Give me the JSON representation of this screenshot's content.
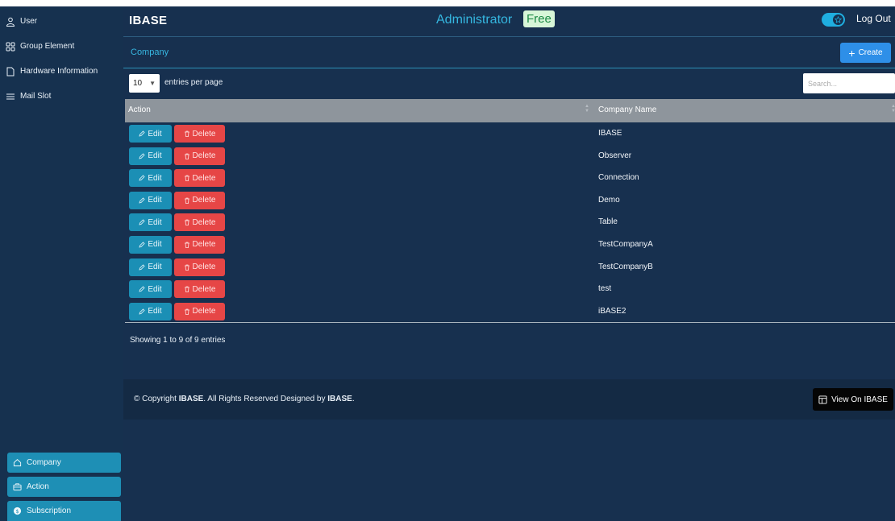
{
  "sidebar": {
    "items": [
      {
        "label": "User",
        "icon": "user-icon"
      },
      {
        "label": "Group Element",
        "icon": "grid-icon"
      },
      {
        "label": "Hardware Information",
        "icon": "file-icon"
      },
      {
        "label": "Mail Slot",
        "icon": "menu-icon"
      }
    ],
    "bottom_items": [
      {
        "label": "Company",
        "icon": "home-icon"
      },
      {
        "label": "Action",
        "icon": "briefcase-icon"
      },
      {
        "label": "Subscription",
        "icon": "coin-icon"
      }
    ]
  },
  "header": {
    "brand": "IBASE",
    "role": "Administrator",
    "plan_badge": "Free",
    "logout_label": "Log Out",
    "toggle_on": true
  },
  "card": {
    "title": "Company",
    "create_label": "Create",
    "entries_value": "10",
    "entries_label": "entries per page",
    "search_placeholder": "Search...",
    "columns": [
      "Action",
      "Company Name"
    ],
    "edit_label": "Edit",
    "delete_label": "Delete",
    "rows": [
      "IBASE",
      "Observer",
      "Connection",
      "Demo",
      "Table",
      "TestCompanyA",
      "TestCompanyB",
      "test",
      "iBASE2"
    ],
    "showing_text": "Showing 1 to 9 of 9 entries"
  },
  "footer": {
    "copyright_prefix": "© Copyright ",
    "copyright_brand": "IBASE",
    "copyright_middle": ". All Rights Reserved Designed by ",
    "copyright_brand2": "IBASE",
    "copyright_suffix": ".",
    "view_label": "View On IBASE"
  },
  "colors": {
    "background": "#17304f",
    "accent": "#1b8fb5",
    "danger": "#e64646",
    "create": "#2e8fe8"
  }
}
